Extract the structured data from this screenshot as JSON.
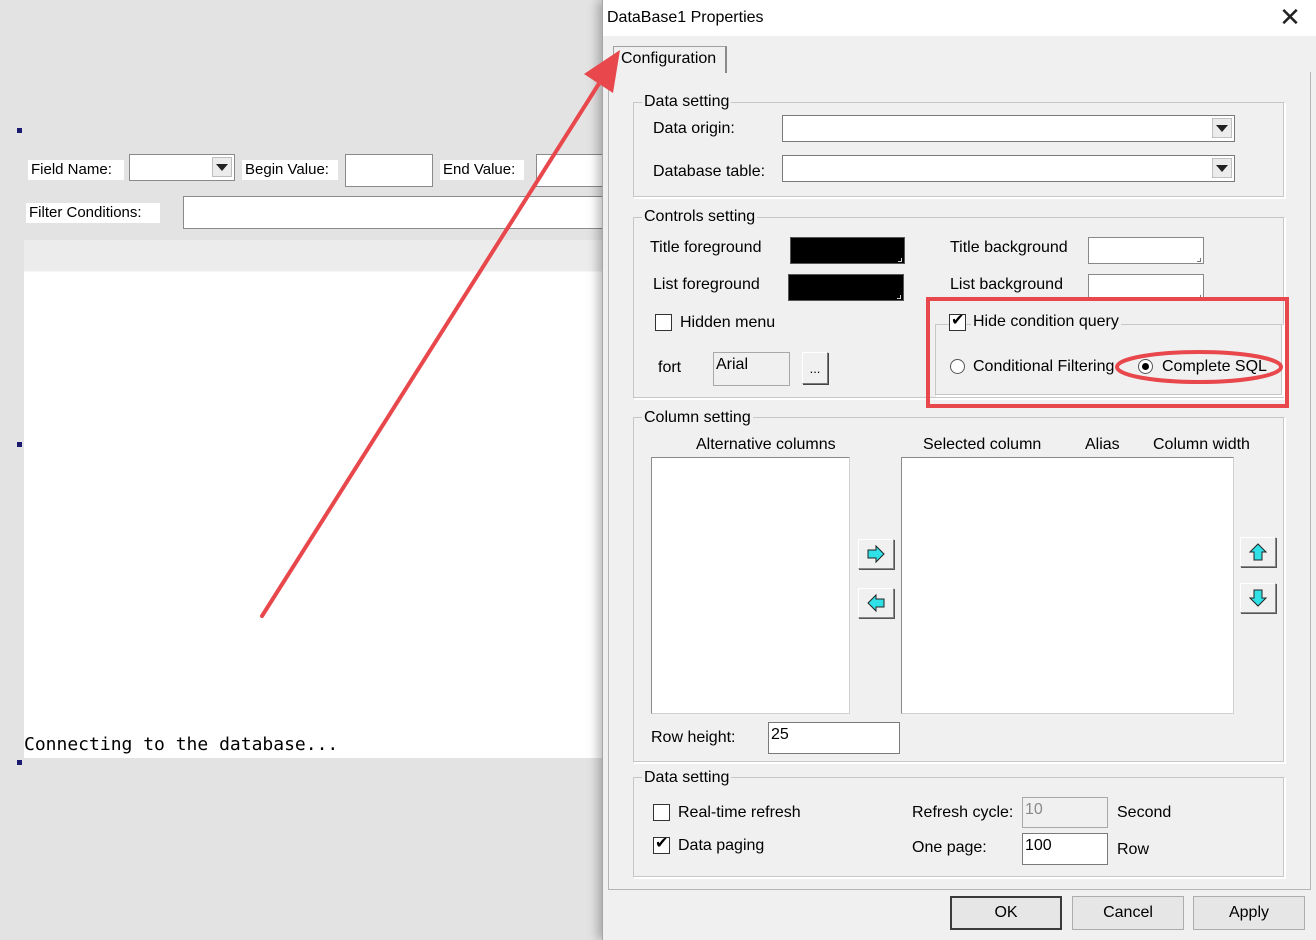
{
  "background_form": {
    "field_name_label": "Field Name:",
    "begin_value_label": "Begin Value:",
    "end_value_label": "End Value:",
    "filter_conditions_label": "Filter Conditions:",
    "status_text": "Connecting to the database..."
  },
  "dialog": {
    "title": "DataBase1 Properties",
    "close_glyph": "✕",
    "tabs": [
      {
        "label": "Configuration"
      }
    ],
    "data_setting": {
      "title": "Data setting",
      "data_origin_label": "Data origin:",
      "data_origin_value": "",
      "database_table_label": "Database table:",
      "database_table_value": ""
    },
    "controls_setting": {
      "title": "Controls setting",
      "title_foreground_label": "Title foreground",
      "title_foreground_color": "#000000",
      "title_background_label": "Title background",
      "title_background_color": "#ffffff",
      "list_foreground_label": "List foreground",
      "list_foreground_color": "#000000",
      "list_background_label": "List background",
      "list_background_color": "#ffffff",
      "hidden_menu_label": "Hidden menu",
      "hidden_menu_checked": false,
      "hide_condition_query_label": "Hide condition query",
      "hide_condition_query_checked": true,
      "conditional_filtering_label": "Conditional Filtering",
      "complete_sql_label": "Complete SQL",
      "selected_mode": "Complete SQL",
      "font_label": "fort",
      "font_value": "Arial",
      "font_button_label": "..."
    },
    "column_setting": {
      "title": "Column setting",
      "alternative_columns_label": "Alternative columns",
      "selected_column_label": "Selected column",
      "alias_label": "Alias",
      "column_width_label": "Column width",
      "row_height_label": "Row height:",
      "row_height_value": "25"
    },
    "data_setting_2": {
      "title": "Data setting",
      "realtime_refresh_label": "Real-time refresh",
      "realtime_refresh_checked": false,
      "refresh_cycle_label": "Refresh cycle:",
      "refresh_cycle_value": "10",
      "refresh_cycle_unit": "Second",
      "data_paging_label": "Data paging",
      "data_paging_checked": true,
      "one_page_label": "One page:",
      "one_page_value": "100",
      "one_page_unit": "Row"
    },
    "buttons": {
      "ok": "OK",
      "cancel": "Cancel",
      "apply": "Apply"
    }
  },
  "annotation": {
    "highlight_color": "#e8474c",
    "arrow_color": "#e8474c",
    "check_glyph": "✔",
    "arrow_right_icon": "arrow-right-icon",
    "arrow_left_icon": "arrow-left-icon",
    "arrow_up_icon": "arrow-up-icon",
    "arrow_down_icon": "arrow-down-icon",
    "arrow_fill_color": "#2fe0e6"
  }
}
